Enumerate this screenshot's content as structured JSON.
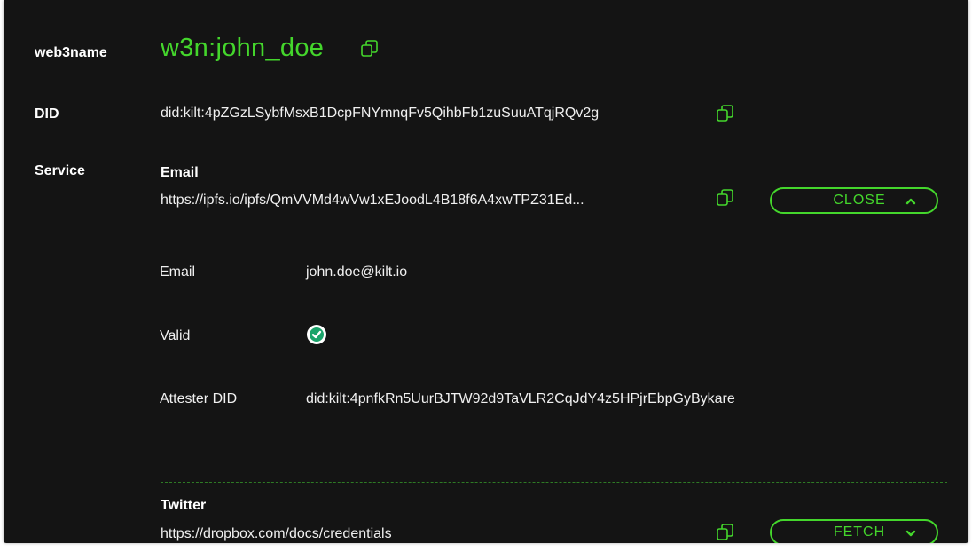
{
  "web3name": {
    "label": "web3name",
    "value": "w3n:john_doe"
  },
  "did": {
    "label": "DID",
    "value": "did:kilt:4pZGzLSybfMsxB1DcpFNYmnqFv5QihbFb1zuSuuATqjRQv2g"
  },
  "service": {
    "label": "Service",
    "items": [
      {
        "name": "Email",
        "url": "https://ipfs.io/ipfs/QmVVMd4wVw1xEJoodL4B18f6A4xwTPZ31Ed...",
        "button_label": "CLOSE",
        "button_icon": "chevron-up-icon",
        "details": {
          "email_label": "Email",
          "email_value": "john.doe@kilt.io",
          "valid_label": "Valid",
          "valid_icon": "check-circle-icon",
          "attester_label": "Attester DID",
          "attester_value": "did:kilt:4pnfkRn5UurBJTW92d9TaVLR2CqJdY4z5HPjrEbpGyBykare"
        }
      },
      {
        "name": "Twitter",
        "url": "https://dropbox.com/docs/credentials",
        "button_label": "FETCH",
        "button_icon": "chevron-down-icon"
      }
    ]
  },
  "colors": {
    "accent": "#44d62c",
    "background": "#141414",
    "text": "#f0f0f0"
  }
}
